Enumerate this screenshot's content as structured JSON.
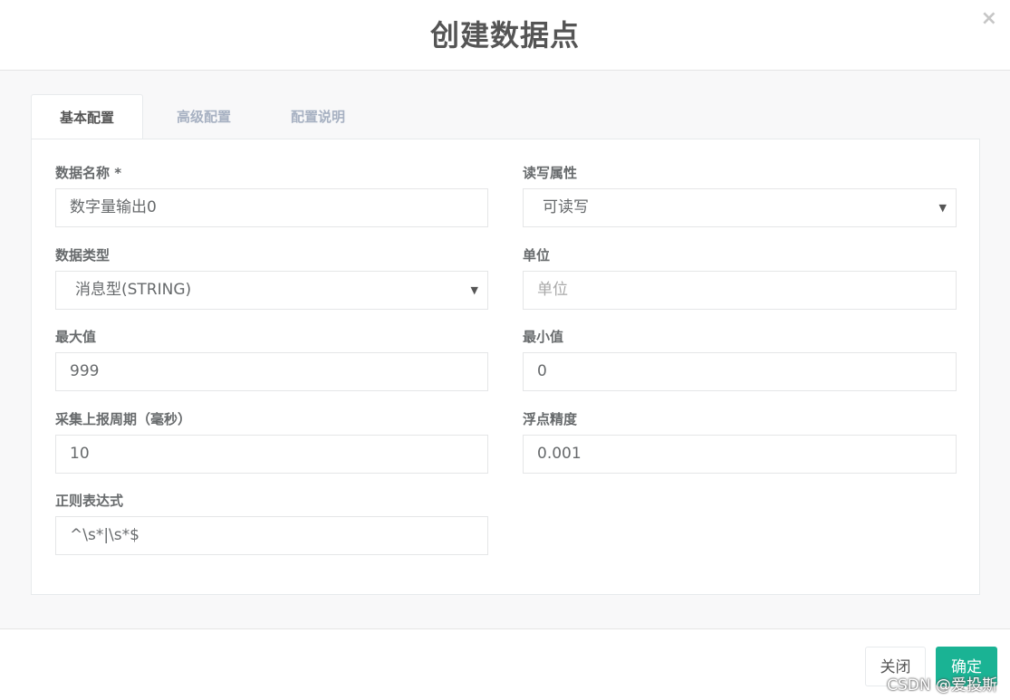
{
  "dialog": {
    "title": "创建数据点",
    "close_icon": "×"
  },
  "tabs": [
    {
      "label": "基本配置",
      "active": true
    },
    {
      "label": "高级配置",
      "active": false
    },
    {
      "label": "配置说明",
      "active": false
    }
  ],
  "form": {
    "name": {
      "label": "数据名称 *",
      "value": "数字量输出0"
    },
    "rw": {
      "label": "读写属性",
      "value": "可读写"
    },
    "datatype": {
      "label": "数据类型",
      "value": "消息型(STRING)"
    },
    "unit": {
      "label": "单位",
      "placeholder": "单位"
    },
    "max": {
      "label": "最大值",
      "value": "999"
    },
    "min": {
      "label": "最小值",
      "value": "0"
    },
    "period": {
      "label": "采集上报周期（毫秒）",
      "value": "10"
    },
    "precision": {
      "label": "浮点精度",
      "value": "0.001"
    },
    "regex": {
      "label": "正则表达式",
      "value": "^\\s*|\\s*$"
    }
  },
  "footer": {
    "close_label": "关闭",
    "ok_label": "确定"
  },
  "watermark": "CSDN @爱投斯",
  "colors": {
    "primary": "#1ab394",
    "body_bg": "#f8f8f9"
  }
}
